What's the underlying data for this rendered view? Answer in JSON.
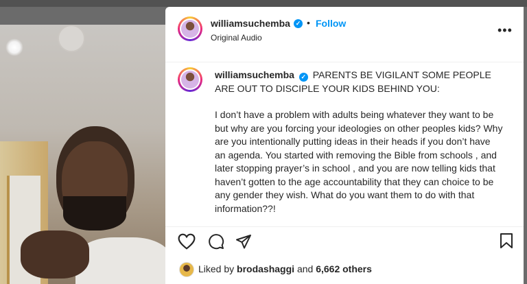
{
  "post": {
    "username": "williamsuchemba",
    "separator": "•",
    "follow_label": "Follow",
    "audio_label": "Original Audio",
    "more_label": "•••",
    "caption": {
      "username": "williamsuchemba",
      "headline": "PARENTS BE VIGILANT SOME PEOPLE ARE OUT TO DISCIPLE YOUR KIDS BEHIND YOU:",
      "body": "I don’t have a problem with adults being whatever they want to be but why are you forcing your ideologies on other peoples kids? Why are you intentionally putting ideas in their heads if you don’t have an agenda. You started with removing the Bible from schools , and later stopping prayer’s in school , and you are now telling kids that haven’t gotten to the age accountability that they can choice to be any gender they wish. What do you want them to do with that information??!"
    },
    "likes": {
      "prefix": "Liked by",
      "user": "brodashaggi",
      "conjunction": "and",
      "count": "6,662 others"
    }
  },
  "icons": {
    "like": "heart-icon",
    "comment": "comment-icon",
    "share": "send-icon",
    "save": "bookmark-icon",
    "verified": "verified-badge-icon"
  },
  "colors": {
    "accent": "#0095f6",
    "text": "#262626"
  }
}
